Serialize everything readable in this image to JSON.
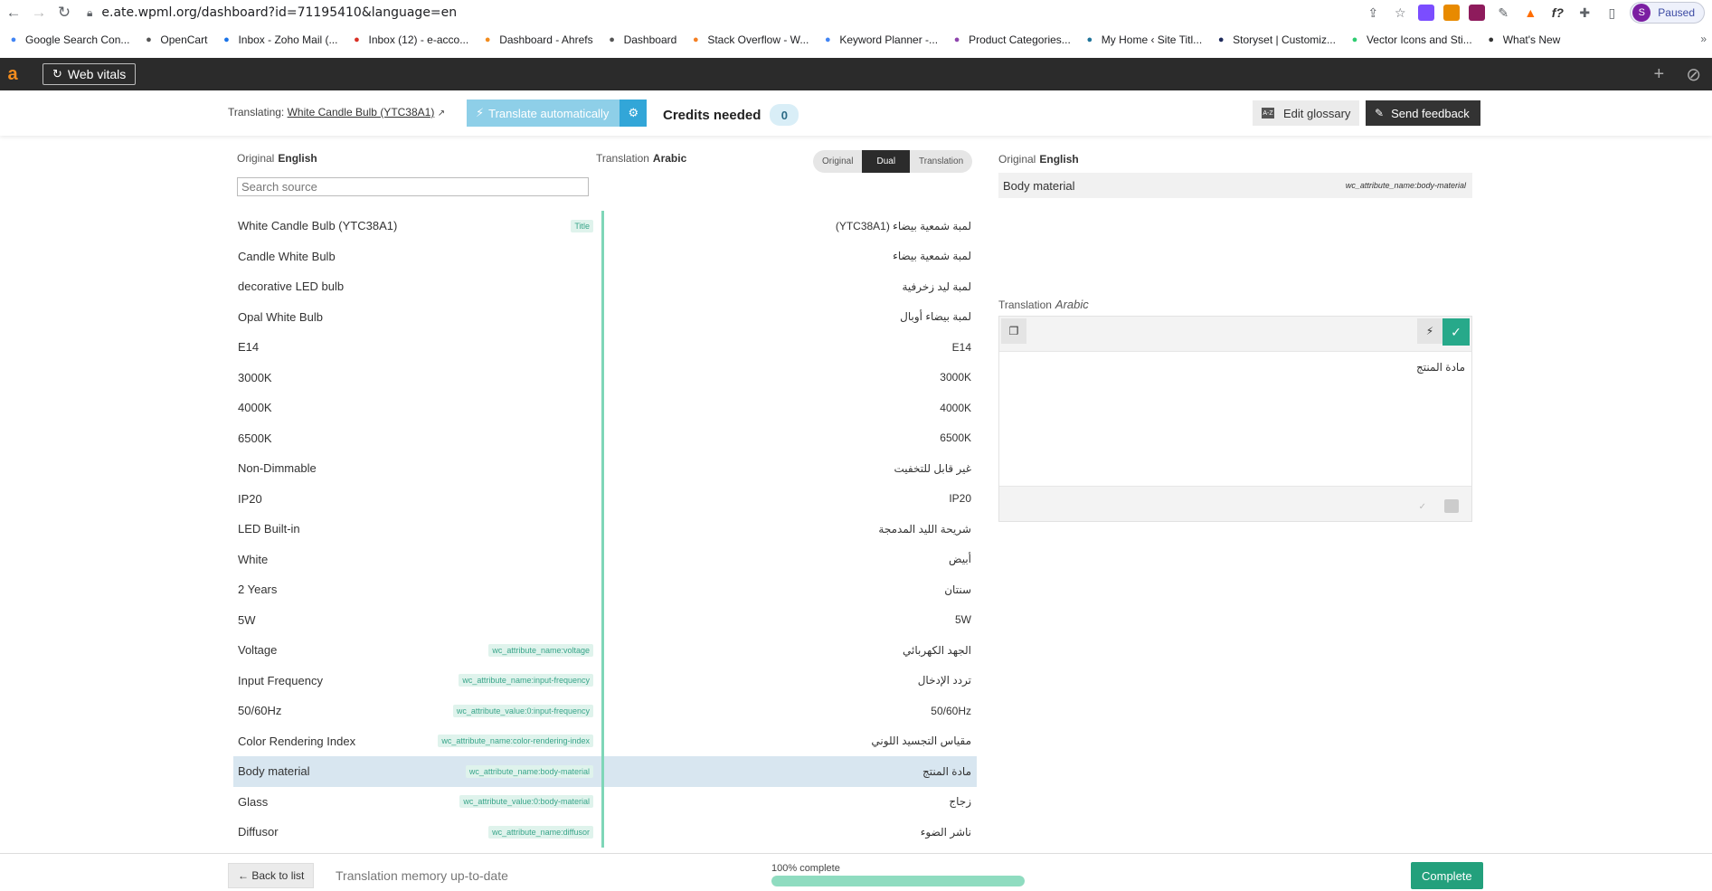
{
  "browser": {
    "url": "e.ate.wpml.org/dashboard?id=71195410&language=en",
    "profile_initial": "S",
    "profile_status": "Paused"
  },
  "bookmarks": [
    {
      "label": "Google Search Con...",
      "icon": "google-icon",
      "color": "#4285f4"
    },
    {
      "label": "OpenCart",
      "icon": "globe-icon",
      "color": "#555555"
    },
    {
      "label": "Inbox - Zoho Mail (...",
      "icon": "zoho-icon",
      "color": "#1a73e8"
    },
    {
      "label": "Inbox (12) - e-acco...",
      "icon": "gmail-icon",
      "color": "#d93025"
    },
    {
      "label": "Dashboard - Ahrefs",
      "icon": "ahrefs-icon",
      "color": "#f28c1e"
    },
    {
      "label": "Dashboard",
      "icon": "globe-icon",
      "color": "#555555"
    },
    {
      "label": "Stack Overflow - W...",
      "icon": "stackoverflow-icon",
      "color": "#f48024"
    },
    {
      "label": "Keyword Planner -...",
      "icon": "google-icon",
      "color": "#4285f4"
    },
    {
      "label": "Product Categories...",
      "icon": "category-icon",
      "color": "#8e44ad"
    },
    {
      "label": "My Home ‹ Site Titl...",
      "icon": "wordpress-icon",
      "color": "#21759b"
    },
    {
      "label": "Storyset | Customiz...",
      "icon": "storyset-icon",
      "color": "#1f2b5c"
    },
    {
      "label": "Vector Icons and Sti...",
      "icon": "vector-icon",
      "color": "#2ecc71"
    },
    {
      "label": "What's New",
      "icon": "github-icon",
      "color": "#333333"
    }
  ],
  "app": {
    "web_vitals_label": "Web vitals"
  },
  "header": {
    "translating_label": "Translating:",
    "translating_item": "White Candle Bulb (YTC38A1)",
    "translate_auto_label": "Translate automatically",
    "credits_label": "Credits needed",
    "credits_count": "0",
    "edit_glossary_label": "Edit glossary",
    "send_feedback_label": "Send feedback"
  },
  "columns": {
    "original_label": "Original",
    "original_lang": "English",
    "translation_label": "Translation",
    "translation_lang": "Arabic",
    "search_placeholder": "Search source",
    "view_modes": [
      "Original",
      "Dual",
      "Translation"
    ],
    "active_view": "Dual"
  },
  "rows": [
    {
      "src": "White Candle Bulb (YTC38A1)",
      "tag": "Title",
      "tgt": "لمبة شمعية بيضاء (YTC38A1)"
    },
    {
      "src": "Candle White Bulb",
      "tag": "",
      "tgt": "لمبة شمعية بيضاء"
    },
    {
      "src": "decorative LED bulb",
      "tag": "",
      "tgt": "لمبة ليد زخرفية"
    },
    {
      "src": "Opal White Bulb",
      "tag": "",
      "tgt": "لمبة بيضاء أوبال"
    },
    {
      "src": "E14",
      "tag": "",
      "tgt": "E14"
    },
    {
      "src": "3000K",
      "tag": "",
      "tgt": "3000K"
    },
    {
      "src": "4000K",
      "tag": "",
      "tgt": "4000K"
    },
    {
      "src": "6500K",
      "tag": "",
      "tgt": "6500K"
    },
    {
      "src": "Non-Dimmable",
      "tag": "",
      "tgt": "غير قابل للتخفيت"
    },
    {
      "src": "IP20",
      "tag": "",
      "tgt": "IP20"
    },
    {
      "src": "LED Built-in",
      "tag": "",
      "tgt": "شريحة الليد المدمجة"
    },
    {
      "src": "White",
      "tag": "",
      "tgt": "أبيض"
    },
    {
      "src": "2 Years",
      "tag": "",
      "tgt": "سنتان"
    },
    {
      "src": "5W",
      "tag": "",
      "tgt": "5W"
    },
    {
      "src": "Voltage",
      "tag": "wc_attribute_name:voltage",
      "tgt": "الجهد الكهربائي"
    },
    {
      "src": "Input Frequency",
      "tag": "wc_attribute_name:input-frequency",
      "tgt": "تردد الإدخال"
    },
    {
      "src": "50/60Hz",
      "tag": "wc_attribute_value:0:input-frequency",
      "tgt": "50/60Hz"
    },
    {
      "src": "Color Rendering Index",
      "tag": "wc_attribute_name:color-rendering-index",
      "tgt": "مقياس التجسيد اللوني"
    },
    {
      "src": "Body material",
      "tag": "wc_attribute_name:body-material",
      "tgt": "مادة المنتج",
      "selected": true
    },
    {
      "src": "Glass",
      "tag": "wc_attribute_value:0:body-material",
      "tgt": "زجاج"
    },
    {
      "src": "Diffusor",
      "tag": "wc_attribute_name:diffusor",
      "tgt": "ناشر الضوء"
    }
  ],
  "editor": {
    "original_label": "Original",
    "original_lang": "English",
    "original_text": "Body material",
    "original_key": "wc_attribute_name:body-material",
    "translation_label": "Translation",
    "translation_lang": "Arabic",
    "translation_text": "مادة المنتج"
  },
  "footer": {
    "back_label": "← Back to list",
    "tm_status": "Translation memory up-to-date",
    "progress_label": "100% complete",
    "progress_percent": 100,
    "complete_label": "Complete"
  },
  "colors": {
    "accent_green": "#23a07c",
    "divider_green": "#7fd6b8",
    "selected_row": "#d8e6f0",
    "translate_auto": "#8ecfe8",
    "dark_bar": "#2b2b2b"
  }
}
